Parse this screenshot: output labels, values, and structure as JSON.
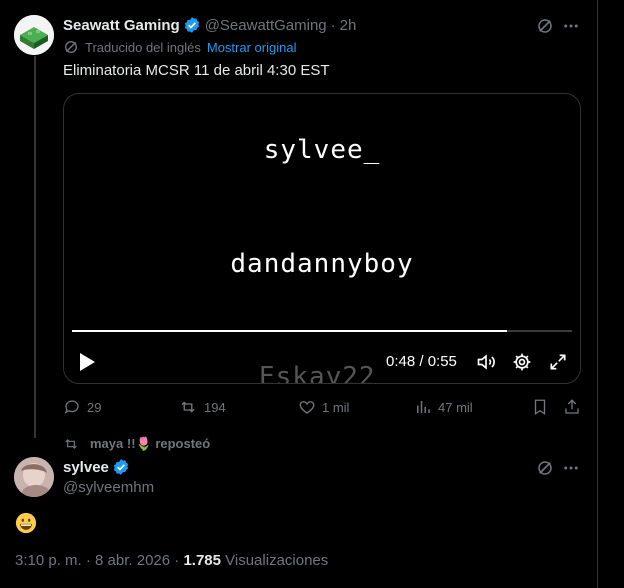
{
  "tweet": {
    "author_name": "Seawatt Gaming",
    "author_handle": "@SeawattGaming",
    "separator": "·",
    "time_ago": "2h",
    "translated_label": "Traducido del inglés",
    "show_original_label": "Mostrar original",
    "text": "Eliminatoria MCSR 11 de abril 4:30 EST",
    "video": {
      "lines": [
        "sylvee_",
        "dandannyboy",
        "Eskay22"
      ],
      "time": "0:48 / 0:55",
      "progress_fraction": 0.87
    },
    "stats": {
      "replies": "29",
      "reposts": "194",
      "likes": "1 mil",
      "views": "47 mil"
    }
  },
  "reply": {
    "reposted_by": "maya !!🌷 reposteó",
    "author_name": "sylvee",
    "author_handle": "@sylveemhm",
    "emoji": "grinning-face",
    "timestamp": "3:10 p. m. · 8 abr. 2026 · ",
    "view_count": "1.785",
    "views_label": " Visualizaciones"
  },
  "colors": {
    "background": "#000000",
    "text": "#e7e9ea",
    "muted": "#71767b",
    "link": "#1d9bf0",
    "verified": "#1d9bf0"
  }
}
